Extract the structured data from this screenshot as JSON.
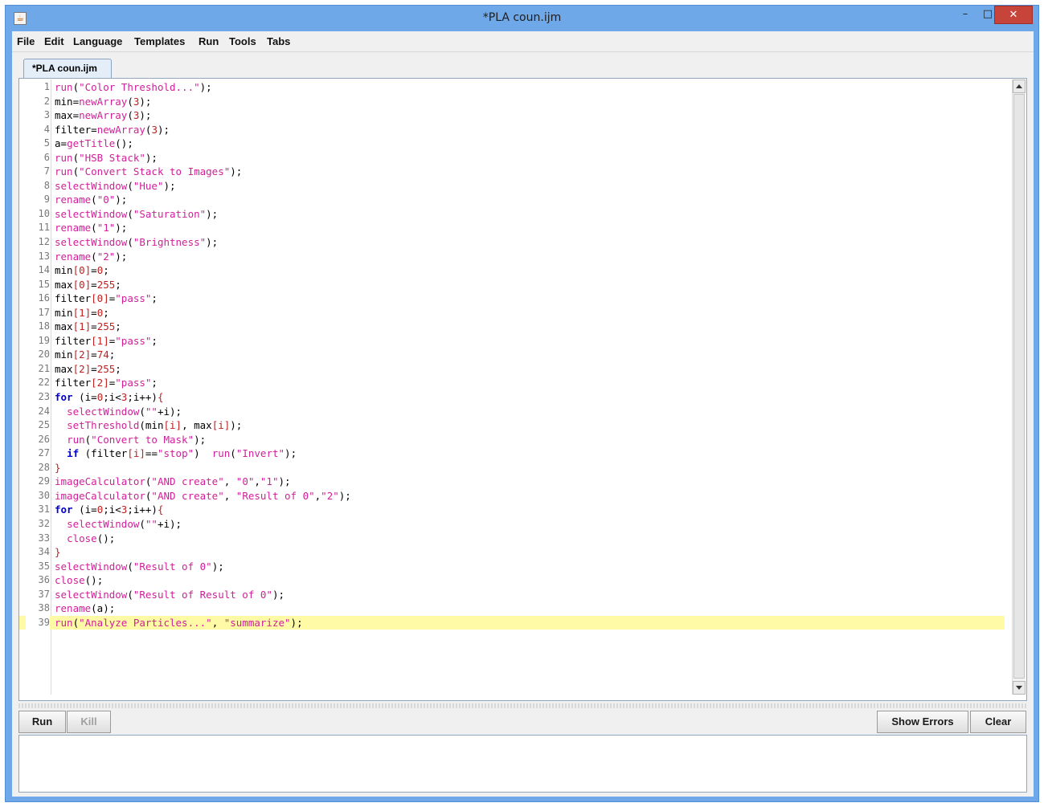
{
  "window": {
    "title": "*PLA coun.ijm",
    "app_icon": "java-icon",
    "min_glyph": "–",
    "max_glyph": "□",
    "close_glyph": "✕"
  },
  "menu": [
    "File",
    "Edit",
    "Language",
    "Templates",
    "Run",
    "Tools",
    "Tabs"
  ],
  "tab": {
    "label": "*PLA coun.ijm"
  },
  "editor": {
    "current_line": 39,
    "lines": [
      {
        "n": "1",
        "t": [
          [
            "fn",
            "run"
          ],
          [
            "var",
            "("
          ],
          [
            "str",
            "\"Color Threshold...\""
          ],
          [
            "var",
            ");"
          ]
        ]
      },
      {
        "n": "2",
        "t": [
          [
            "var",
            "min="
          ],
          [
            "fn",
            "newArray"
          ],
          [
            "var",
            "("
          ],
          [
            "num",
            "3"
          ],
          [
            "var",
            ");"
          ]
        ]
      },
      {
        "n": "3",
        "t": [
          [
            "var",
            "max="
          ],
          [
            "fn",
            "newArray"
          ],
          [
            "var",
            "("
          ],
          [
            "num",
            "3"
          ],
          [
            "var",
            ");"
          ]
        ]
      },
      {
        "n": "4",
        "t": [
          [
            "var",
            "filter="
          ],
          [
            "fn",
            "newArray"
          ],
          [
            "var",
            "("
          ],
          [
            "num",
            "3"
          ],
          [
            "var",
            ");"
          ]
        ]
      },
      {
        "n": "5",
        "t": [
          [
            "var",
            "a="
          ],
          [
            "fn",
            "getTitle"
          ],
          [
            "var",
            "();"
          ]
        ]
      },
      {
        "n": "6",
        "t": [
          [
            "fn",
            "run"
          ],
          [
            "var",
            "("
          ],
          [
            "str",
            "\"HSB Stack\""
          ],
          [
            "var",
            ");"
          ]
        ]
      },
      {
        "n": "7",
        "t": [
          [
            "fn",
            "run"
          ],
          [
            "var",
            "("
          ],
          [
            "str",
            "\"Convert Stack to Images\""
          ],
          [
            "var",
            ");"
          ]
        ]
      },
      {
        "n": "8",
        "t": [
          [
            "fn",
            "selectWindow"
          ],
          [
            "var",
            "("
          ],
          [
            "str",
            "\"Hue\""
          ],
          [
            "var",
            ");"
          ]
        ]
      },
      {
        "n": "9",
        "t": [
          [
            "fn",
            "rename"
          ],
          [
            "var",
            "("
          ],
          [
            "str",
            "\"0\""
          ],
          [
            "var",
            ");"
          ]
        ]
      },
      {
        "n": "10",
        "t": [
          [
            "fn",
            "selectWindow"
          ],
          [
            "var",
            "("
          ],
          [
            "str",
            "\"Saturation\""
          ],
          [
            "var",
            ");"
          ]
        ]
      },
      {
        "n": "11",
        "t": [
          [
            "fn",
            "rename"
          ],
          [
            "var",
            "("
          ],
          [
            "str",
            "\"1\""
          ],
          [
            "var",
            ");"
          ]
        ]
      },
      {
        "n": "12",
        "t": [
          [
            "fn",
            "selectWindow"
          ],
          [
            "var",
            "("
          ],
          [
            "str",
            "\"Brightness\""
          ],
          [
            "var",
            ");"
          ]
        ]
      },
      {
        "n": "13",
        "t": [
          [
            "fn",
            "rename"
          ],
          [
            "var",
            "("
          ],
          [
            "str",
            "\"2\""
          ],
          [
            "var",
            ");"
          ]
        ]
      },
      {
        "n": "14",
        "t": [
          [
            "var",
            "min"
          ],
          [
            "num",
            "[0]"
          ],
          [
            "var",
            "="
          ],
          [
            "num",
            "0"
          ],
          [
            "var",
            ";"
          ]
        ]
      },
      {
        "n": "15",
        "t": [
          [
            "var",
            "max"
          ],
          [
            "num",
            "[0]"
          ],
          [
            "var",
            "="
          ],
          [
            "num",
            "255"
          ],
          [
            "var",
            ";"
          ]
        ]
      },
      {
        "n": "16",
        "t": [
          [
            "var",
            "filter"
          ],
          [
            "num",
            "[0]"
          ],
          [
            "var",
            "="
          ],
          [
            "str",
            "\"pass\""
          ],
          [
            "var",
            ";"
          ]
        ]
      },
      {
        "n": "17",
        "t": [
          [
            "var",
            "min"
          ],
          [
            "num",
            "[1]"
          ],
          [
            "var",
            "="
          ],
          [
            "num",
            "0"
          ],
          [
            "var",
            ";"
          ]
        ]
      },
      {
        "n": "18",
        "t": [
          [
            "var",
            "max"
          ],
          [
            "num",
            "[1]"
          ],
          [
            "var",
            "="
          ],
          [
            "num",
            "255"
          ],
          [
            "var",
            ";"
          ]
        ]
      },
      {
        "n": "19",
        "t": [
          [
            "var",
            "filter"
          ],
          [
            "num",
            "[1]"
          ],
          [
            "var",
            "="
          ],
          [
            "str",
            "\"pass\""
          ],
          [
            "var",
            ";"
          ]
        ]
      },
      {
        "n": "20",
        "t": [
          [
            "var",
            "min"
          ],
          [
            "num",
            "[2]"
          ],
          [
            "var",
            "="
          ],
          [
            "num",
            "74"
          ],
          [
            "var",
            ";"
          ]
        ]
      },
      {
        "n": "21",
        "t": [
          [
            "var",
            "max"
          ],
          [
            "num",
            "[2]"
          ],
          [
            "var",
            "="
          ],
          [
            "num",
            "255"
          ],
          [
            "var",
            ";"
          ]
        ]
      },
      {
        "n": "22",
        "t": [
          [
            "var",
            "filter"
          ],
          [
            "num",
            "[2]"
          ],
          [
            "var",
            "="
          ],
          [
            "str",
            "\"pass\""
          ],
          [
            "var",
            ";"
          ]
        ]
      },
      {
        "n": "23",
        "t": [
          [
            "kw",
            "for"
          ],
          [
            "var",
            " (i="
          ],
          [
            "num",
            "0"
          ],
          [
            "var",
            ";i<"
          ],
          [
            "num",
            "3"
          ],
          [
            "var",
            ";i++)"
          ],
          [
            "num",
            "{"
          ]
        ]
      },
      {
        "n": "24",
        "t": [
          [
            "var",
            "  "
          ],
          [
            "fn",
            "selectWindow"
          ],
          [
            "var",
            "("
          ],
          [
            "str",
            "\"\""
          ],
          [
            "var",
            "+i);"
          ]
        ]
      },
      {
        "n": "25",
        "t": [
          [
            "var",
            "  "
          ],
          [
            "fn",
            "setThreshold"
          ],
          [
            "var",
            "(min"
          ],
          [
            "num",
            "[i]"
          ],
          [
            "var",
            ", max"
          ],
          [
            "num",
            "[i]"
          ],
          [
            "var",
            ");"
          ]
        ]
      },
      {
        "n": "26",
        "t": [
          [
            "var",
            "  "
          ],
          [
            "fn",
            "run"
          ],
          [
            "var",
            "("
          ],
          [
            "str",
            "\"Convert to Mask\""
          ],
          [
            "var",
            ");"
          ]
        ]
      },
      {
        "n": "27",
        "t": [
          [
            "var",
            "  "
          ],
          [
            "kw",
            "if"
          ],
          [
            "var",
            " (filter"
          ],
          [
            "num",
            "[i]"
          ],
          [
            "var",
            "=="
          ],
          [
            "str",
            "\"stop\""
          ],
          [
            "var",
            ")  "
          ],
          [
            "fn",
            "run"
          ],
          [
            "var",
            "("
          ],
          [
            "str",
            "\"Invert\""
          ],
          [
            "var",
            ");"
          ]
        ]
      },
      {
        "n": "28",
        "t": [
          [
            "num",
            "}"
          ]
        ]
      },
      {
        "n": "29",
        "t": [
          [
            "fn",
            "imageCalculator"
          ],
          [
            "var",
            "("
          ],
          [
            "str",
            "\"AND create\""
          ],
          [
            "var",
            ", "
          ],
          [
            "str",
            "\"0\""
          ],
          [
            "var",
            ","
          ],
          [
            "str",
            "\"1\""
          ],
          [
            "var",
            ");"
          ]
        ]
      },
      {
        "n": "30",
        "t": [
          [
            "fn",
            "imageCalculator"
          ],
          [
            "var",
            "("
          ],
          [
            "str",
            "\"AND create\""
          ],
          [
            "var",
            ", "
          ],
          [
            "str",
            "\"Result of 0\""
          ],
          [
            "var",
            ","
          ],
          [
            "str",
            "\"2\""
          ],
          [
            "var",
            ");"
          ]
        ]
      },
      {
        "n": "31",
        "t": [
          [
            "kw",
            "for"
          ],
          [
            "var",
            " (i="
          ],
          [
            "num",
            "0"
          ],
          [
            "var",
            ";i<"
          ],
          [
            "num",
            "3"
          ],
          [
            "var",
            ";i++)"
          ],
          [
            "num",
            "{"
          ]
        ]
      },
      {
        "n": "32",
        "t": [
          [
            "var",
            "  "
          ],
          [
            "fn",
            "selectWindow"
          ],
          [
            "var",
            "("
          ],
          [
            "str",
            "\"\""
          ],
          [
            "var",
            "+i);"
          ]
        ]
      },
      {
        "n": "33",
        "t": [
          [
            "var",
            "  "
          ],
          [
            "fn",
            "close"
          ],
          [
            "var",
            "();"
          ]
        ]
      },
      {
        "n": "34",
        "t": [
          [
            "num",
            "}"
          ]
        ]
      },
      {
        "n": "35",
        "t": [
          [
            "fn",
            "selectWindow"
          ],
          [
            "var",
            "("
          ],
          [
            "str",
            "\"Result of 0\""
          ],
          [
            "var",
            ");"
          ]
        ]
      },
      {
        "n": "36",
        "t": [
          [
            "fn",
            "close"
          ],
          [
            "var",
            "();"
          ]
        ]
      },
      {
        "n": "37",
        "t": [
          [
            "fn",
            "selectWindow"
          ],
          [
            "var",
            "("
          ],
          [
            "str",
            "\"Result of Result of 0\""
          ],
          [
            "var",
            ");"
          ]
        ]
      },
      {
        "n": "38",
        "t": [
          [
            "fn",
            "rename"
          ],
          [
            "var",
            "(a);"
          ]
        ]
      },
      {
        "n": "39",
        "t": [
          [
            "fn",
            "run"
          ],
          [
            "var",
            "("
          ],
          [
            "str",
            "\"Analyze Particles...\""
          ],
          [
            "var",
            ", "
          ],
          [
            "str",
            "\"summarize\""
          ],
          [
            "var",
            ");"
          ]
        ]
      }
    ]
  },
  "buttons": {
    "run": "Run",
    "kill": "Kill",
    "show_errors": "Show Errors",
    "clear": "Clear"
  },
  "output": {
    "text": ""
  },
  "colors": {
    "keyword": "#0000d0",
    "function": "#d0209a",
    "string": "#d0209a",
    "number": "#c02020",
    "current_line": "#fffaa6"
  }
}
